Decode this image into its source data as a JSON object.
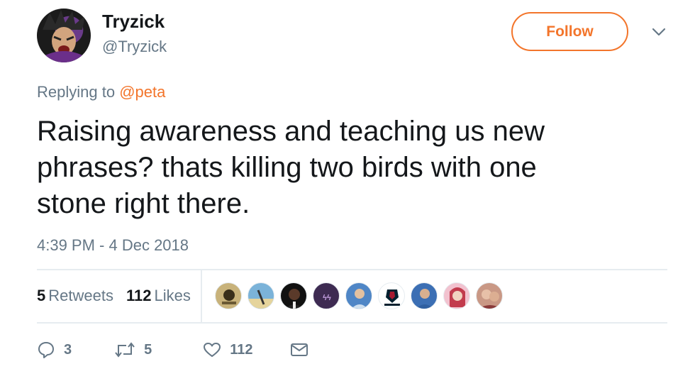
{
  "author": {
    "name": "Tryzick",
    "handle": "@Tryzick"
  },
  "follow_button": {
    "label": "Follow"
  },
  "reply": {
    "prefix": "Replying to",
    "mention": "@peta"
  },
  "tweet": {
    "text_lines": [
      "Raising awareness and teaching us new",
      "phrases? thats killing two birds with one",
      "stone right there."
    ],
    "timestamp": "4:39 PM - 4 Dec 2018"
  },
  "stats": {
    "retweets_count": "5",
    "retweets_label": "Retweets",
    "likes_count": "112",
    "likes_label": "Likes"
  },
  "likers": [
    {
      "icon": "avatar-badge",
      "color": "#c8b27a"
    },
    {
      "icon": "avatar-beach",
      "color": "#7bb3d9"
    },
    {
      "icon": "avatar-person-dark",
      "color": "#2b2b2b"
    },
    {
      "icon": "avatar-purple",
      "color": "#4b2f5e"
    },
    {
      "icon": "avatar-person-blue",
      "color": "#5b8fcf"
    },
    {
      "icon": "avatar-texans-logo",
      "color": "#ffffff"
    },
    {
      "icon": "avatar-person-blue-shirt",
      "color": "#3c6fb4"
    },
    {
      "icon": "avatar-woman-red",
      "color": "#d7728b"
    },
    {
      "icon": "avatar-couple",
      "color": "#b9826e"
    }
  ],
  "actions": {
    "reply_count": "3",
    "retweet_count": "5",
    "like_count": "112"
  },
  "colors": {
    "accent": "#f3752b",
    "muted": "#657786",
    "text": "#14171a",
    "divider": "#e6ecf0"
  }
}
